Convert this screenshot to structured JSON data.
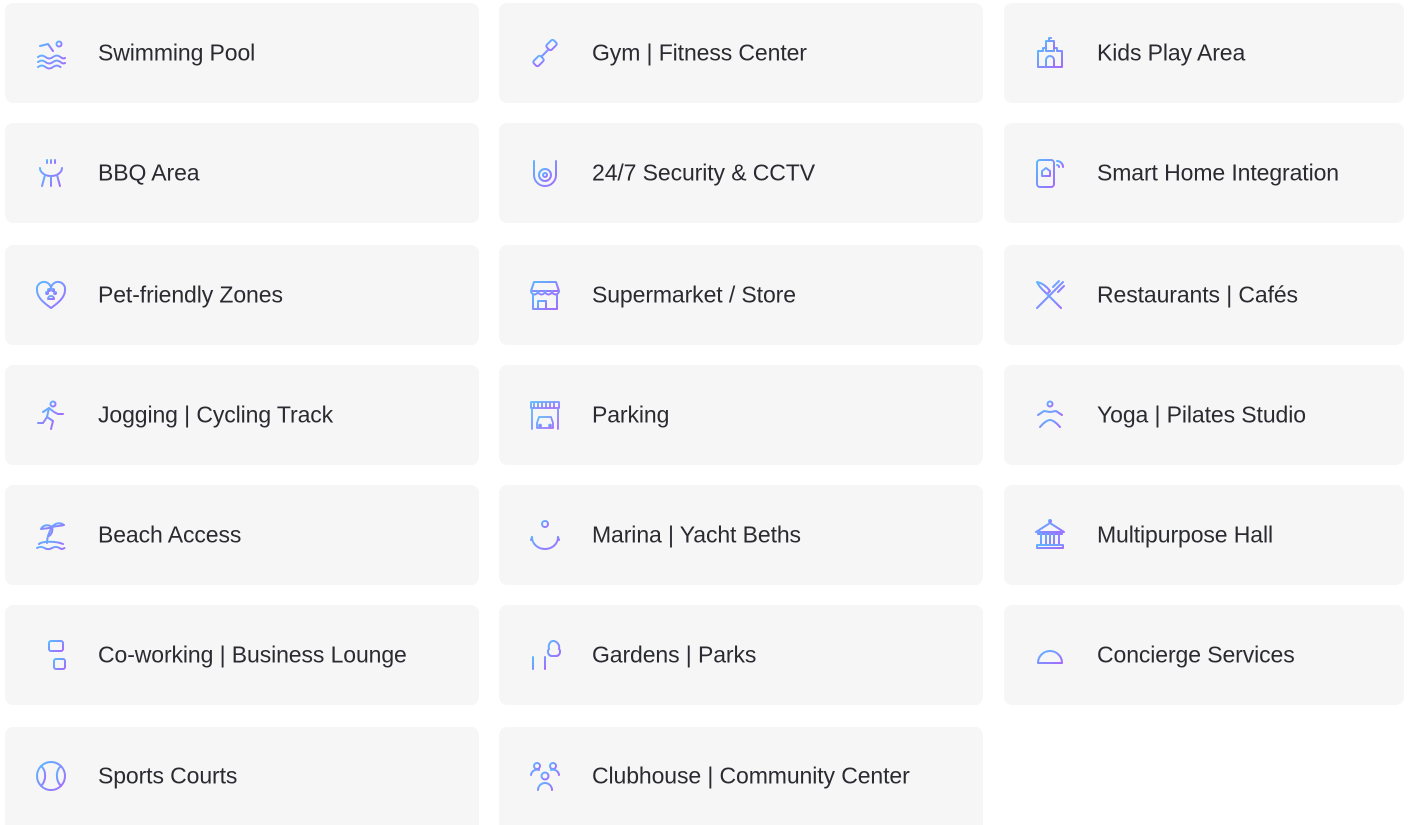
{
  "accent": {
    "gradient_start": "#5ab8ff",
    "gradient_end": "#a36bff"
  },
  "amenities": [
    {
      "label": "Swimming Pool",
      "icon": "swimming-pool-icon"
    },
    {
      "label": "Gym | Fitness Center",
      "icon": "dumbbell-icon"
    },
    {
      "label": "Kids Play Area",
      "icon": "castle-icon"
    },
    {
      "label": "BBQ Area",
      "icon": "bbq-grill-icon"
    },
    {
      "label": "24/7 Security & CCTV",
      "icon": "cctv-camera-icon"
    },
    {
      "label": "Smart Home Integration",
      "icon": "smartphone-wifi-icon"
    },
    {
      "label": "Pet-friendly Zones",
      "icon": "heart-paw-icon"
    },
    {
      "label": "Supermarket / Store",
      "icon": "storefront-icon"
    },
    {
      "label": "Restaurants | Cafés",
      "icon": "fork-knife-icon"
    },
    {
      "label": "Jogging | Cycling Track",
      "icon": "runner-icon"
    },
    {
      "label": "Parking",
      "icon": "garage-car-icon"
    },
    {
      "label": "Yoga | Pilates Studio",
      "icon": "yoga-pose-icon"
    },
    {
      "label": "Beach Access",
      "icon": "palm-island-icon"
    },
    {
      "label": "Marina | Yacht Beths",
      "icon": "anchor-icon"
    },
    {
      "label": "Multipurpose Hall",
      "icon": "hall-building-icon"
    },
    {
      "label": "Co-working | Business Lounge",
      "icon": "desk-chair-icon"
    },
    {
      "label": "Gardens | Parks",
      "icon": "park-bench-tree-icon"
    },
    {
      "label": "Concierge Services",
      "icon": "concierge-bell-icon"
    },
    {
      "label": "Sports Courts",
      "icon": "tennis-ball-icon"
    },
    {
      "label": "Clubhouse | Community Center",
      "icon": "people-group-icon"
    }
  ]
}
